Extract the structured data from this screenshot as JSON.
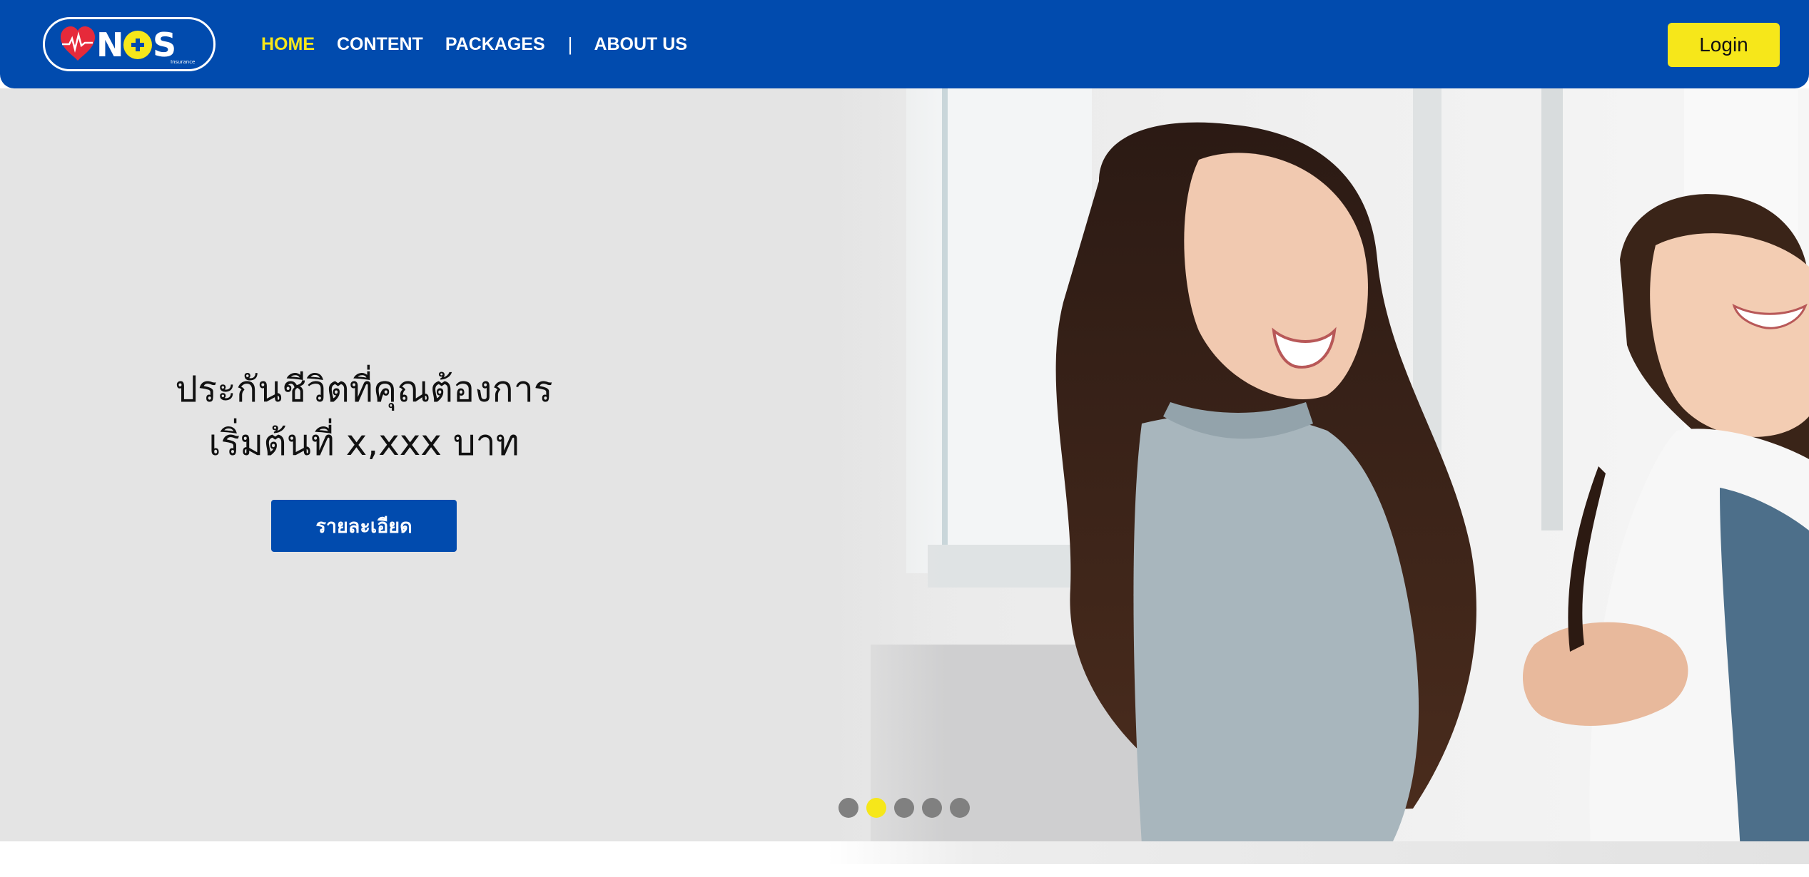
{
  "brand": {
    "name": "NOS",
    "tagline": "Insurance",
    "icons": [
      "heart-pulse-icon",
      "plus-icon"
    ],
    "colors": {
      "primary": "#014bae",
      "accent": "#f6e71a",
      "heart": "#e62a3a"
    }
  },
  "nav": {
    "items": [
      {
        "label": "HOME",
        "active": true
      },
      {
        "label": "CONTENT",
        "active": false
      },
      {
        "label": "PACKAGES",
        "active": false
      }
    ],
    "separator": "|",
    "about": "ABOUT US",
    "login": "Login"
  },
  "hero": {
    "title_line1": "ประกันชีวิตที่คุณต้องการ",
    "title_line2": "เริ่มต้นที่ x,xxx บาท",
    "button": "รายละเอียด",
    "slides_total": 5,
    "active_slide": 2
  }
}
